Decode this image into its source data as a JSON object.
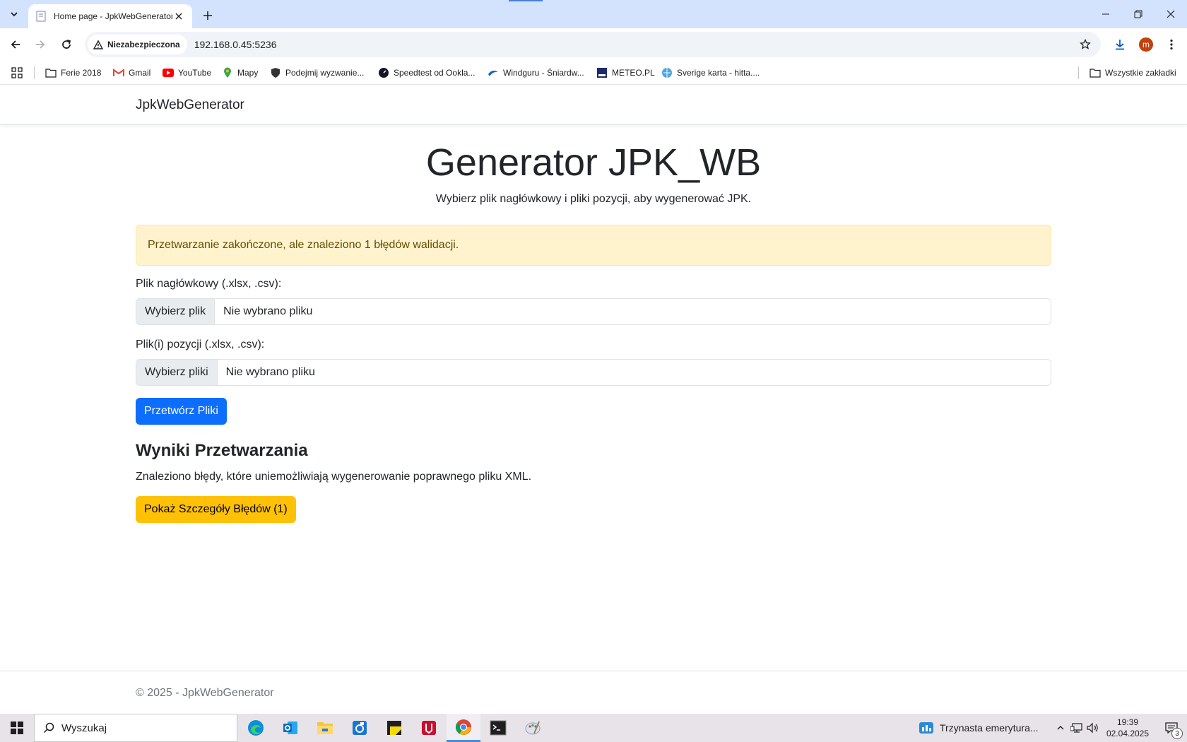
{
  "browser": {
    "tab": {
      "title": "Home page - JpkWebGenerator"
    },
    "omnibox": {
      "security_label": "Niezabezpieczona",
      "url": "192.168.0.45:5236"
    },
    "profile_initial": "m",
    "bookmarks": [
      {
        "label": "Ferie 2018",
        "icon": "folder-icon"
      },
      {
        "label": "Gmail",
        "icon": "gmail-icon"
      },
      {
        "label": "YouTube",
        "icon": "youtube-icon"
      },
      {
        "label": "Mapy",
        "icon": "maps-pin-icon"
      },
      {
        "label": "Podejmij wyzwanie...",
        "icon": "shield-icon"
      },
      {
        "label": "Speedtest od Ookla...",
        "icon": "speedtest-icon"
      },
      {
        "label": "Windguru - Śniardw...",
        "icon": "windguru-icon"
      },
      {
        "label": "METEO.PL",
        "icon": "meteo-icon"
      },
      {
        "label": "Sverige karta - hitta....",
        "icon": "globe-icon"
      }
    ],
    "all_bookmarks_label": "Wszystkie zakładki"
  },
  "site": {
    "brand": "JpkWebGenerator",
    "title": "Generator JPK_WB",
    "subtitle": "Wybierz plik nagłówkowy i pliki pozycji, aby wygenerować JPK.",
    "alert": "Przetwarzanie zakończone, ale znaleziono 1 błędów walidacji.",
    "header_file": {
      "label": "Plik nagłówkowy (.xlsx, .csv):",
      "button": "Wybierz plik",
      "status": "Nie wybrano pliku"
    },
    "position_files": {
      "label": "Plik(i) pozycji (.xlsx, .csv):",
      "button": "Wybierz pliki",
      "status": "Nie wybrano pliku"
    },
    "process_button": "Przetwórz Pliki",
    "results": {
      "title": "Wyniki Przetwarzania",
      "text": "Znaleziono błędy, które uniemożliwiają wygenerowanie poprawnego pliku XML.",
      "details_button": "Pokaż Szczegóły Błędów (1)"
    },
    "footer": "© 2025 - JpkWebGenerator"
  },
  "taskbar": {
    "search_placeholder": "Wyszukaj",
    "news": "Trzynasta emerytura...",
    "time": "19:39",
    "date": "02.04.2025",
    "notification_count": "3"
  },
  "colors": {
    "primary": "#0d6efd",
    "warning": "#ffc107",
    "alert_bg": "#fff3cd",
    "tabbar": "#d3e3fd"
  }
}
